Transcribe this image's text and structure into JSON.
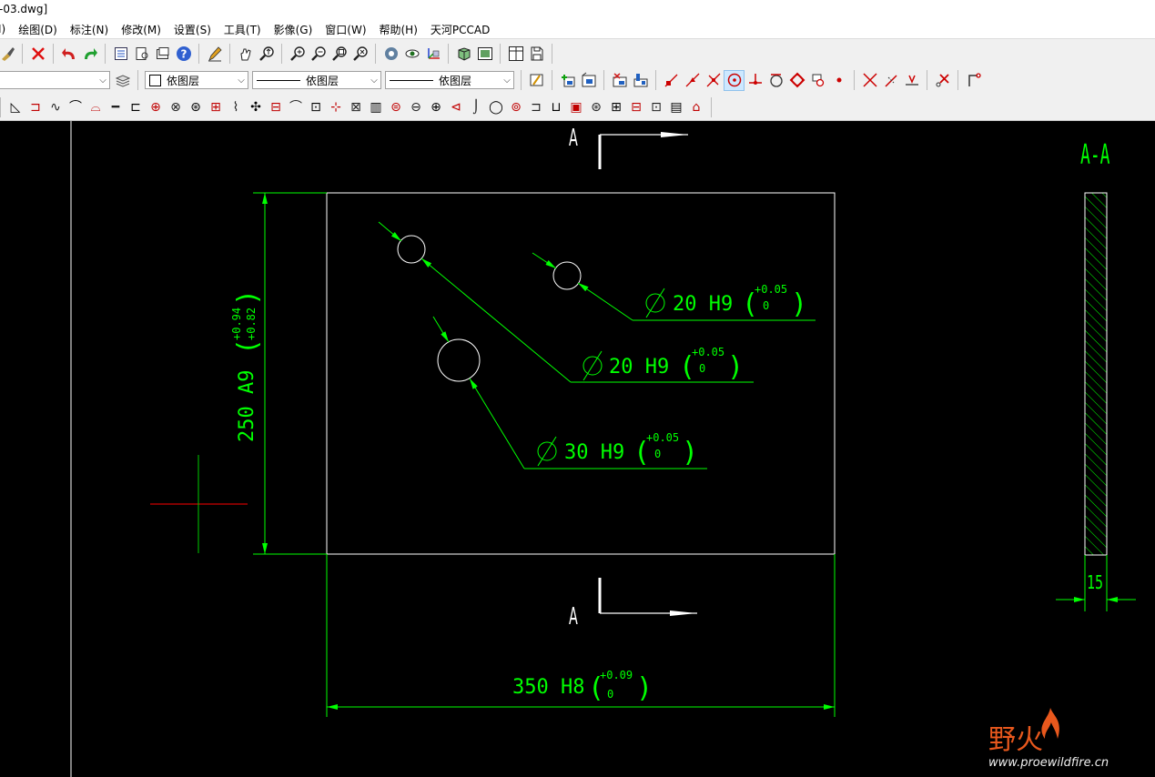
{
  "window": {
    "title": "-03.dwg]"
  },
  "menu": [
    {
      "label": "I)"
    },
    {
      "label": "绘图(D)"
    },
    {
      "label": "标注(N)"
    },
    {
      "label": "修改(M)"
    },
    {
      "label": "设置(S)"
    },
    {
      "label": "工具(T)"
    },
    {
      "label": "影像(G)"
    },
    {
      "label": "窗口(W)"
    },
    {
      "label": "帮助(H)"
    },
    {
      "label": "天河PCCAD"
    }
  ],
  "layer_combos": {
    "layer_value": "",
    "color_value": "依图层",
    "linetype_value": "依图层",
    "lineweight_value": "依图层"
  },
  "icons": {
    "toolbar1": [
      "brush-icon",
      "delete-icon",
      "undo-icon",
      "redo-icon",
      "properties-icon",
      "layer-state-icon",
      "layer-manager-icon",
      "help-icon",
      "pencil-icon",
      "pan-icon",
      "zoom-realtime-icon",
      "zoom-in-icon",
      "zoom-out-icon",
      "zoom-window-icon",
      "zoom-all-icon",
      "render-icon",
      "view-icon",
      "3d-axes-icon",
      "3d-box-icon",
      "view-manager-icon",
      "tile-window-icon",
      "save-icon"
    ],
    "toolbar2": [
      "layer-match-icon",
      "insert-block-icon",
      "edit-block-icon",
      "x-attach-icon",
      "attribute-icon",
      "snap-endpoint-icon",
      "snap-midpoint-icon",
      "snap-intersection-icon",
      "snap-center-icon",
      "snap-perpendicular-icon",
      "snap-tangent-icon",
      "snap-quadrant-icon",
      "snap-insert-icon",
      "snap-node-icon",
      "snap-apparent-icon",
      "snap-extension-icon",
      "snap-nearest-icon",
      "snap-none-icon",
      "snap-settings-icon"
    ],
    "toolbar3": [
      "slope-icon",
      "weld-symbol-icon",
      "wave-icon",
      "fillet-symbol-icon",
      "chamfer-symbol-icon",
      "pin-icon",
      "bracket-icon",
      "bolt-icon",
      "nut-icon",
      "bearing-icon",
      "flange-icon",
      "spring-icon",
      "gear-icon",
      "key-icon",
      "pipe-bend-icon",
      "coupling-icon",
      "center-mark-icon",
      "valve-icon",
      "seal-icon",
      "shaft-icon",
      "cam-icon",
      "cross-hatch-icon",
      "section-arrow-icon",
      "hook-icon",
      "ring-icon",
      "wheel-icon",
      "clamp-icon",
      "plug-icon",
      "sleeve-icon",
      "disc-icon",
      "frame-icon",
      "rail-icon",
      "shaft-block-icon",
      "motor-icon",
      "pump-icon"
    ]
  },
  "drawing": {
    "section_label_top": "A",
    "section_label_bottom": "A",
    "section_view_title": "A-A",
    "dim_height": {
      "text": "250  A9",
      "tol_upper": "+0.94",
      "tol_lower": "+0.82"
    },
    "dim_width": {
      "text": "350  H8",
      "tol_upper": "+0.09",
      "tol_lower": "0"
    },
    "dim_thickness": {
      "text": "15"
    },
    "hole1": {
      "text": "20  H9",
      "tol_upper": "+0.05",
      "tol_lower": "0"
    },
    "hole2": {
      "text": "20  H9",
      "tol_upper": "+0.05",
      "tol_lower": "0"
    },
    "hole3": {
      "text": "30  H9",
      "tol_upper": "+0.05",
      "tol_lower": "0"
    }
  },
  "watermark": {
    "brand_cn": "野火",
    "url": "www.proewildfire.cn"
  },
  "colors": {
    "dimension": "#00ff00",
    "outline": "#ffffff",
    "crosshair_h": "#ff0000",
    "crosshair_v": "#00cc00",
    "background": "#000000",
    "watermark": "#e8581d"
  }
}
